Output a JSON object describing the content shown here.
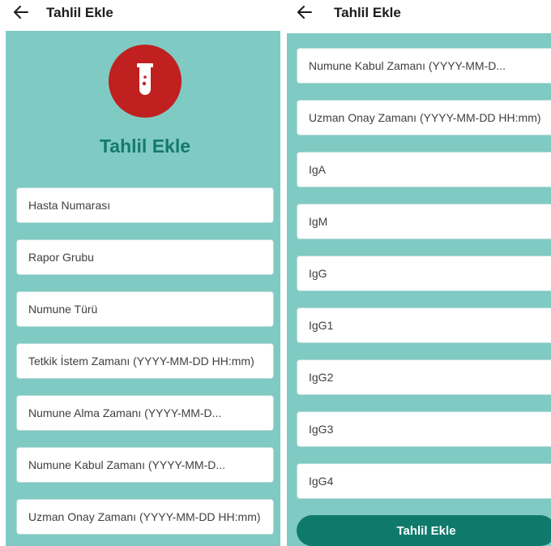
{
  "appbar": {
    "title": "Tahlil Ekle"
  },
  "form": {
    "heading": "Tahlil Ekle",
    "submit_label": "Tahlil Ekle",
    "fields": {
      "hasta_numarasi": "Hasta Numarası",
      "rapor_grubu": "Rapor Grubu",
      "numune_turu": "Numune Türü",
      "tetkik_istem_zamani": "Tetkik İstem Zamanı (YYYY-MM-DD HH:mm)",
      "numune_alma_zamani": "Numune Alma Zamanı (YYYY-MM-D...",
      "numune_kabul_zamani": "Numune Kabul Zamanı (YYYY-MM-D...",
      "uzman_onay_zamani": "Uzman Onay Zamanı (YYYY-MM-DD HH:mm)",
      "iga": "IgA",
      "igm": "IgM",
      "igg": "IgG",
      "igg1": "IgG1",
      "igg2": "IgG2",
      "igg3": "IgG3",
      "igg4": "IgG4"
    }
  },
  "colors": {
    "panel_background": "#7fcac3",
    "accent": "#14796d",
    "button": "#0f7a6b",
    "logo_circle": "#c0201f"
  },
  "icons": {
    "back": "arrow-left-icon",
    "logo": "test-tube-icon"
  }
}
